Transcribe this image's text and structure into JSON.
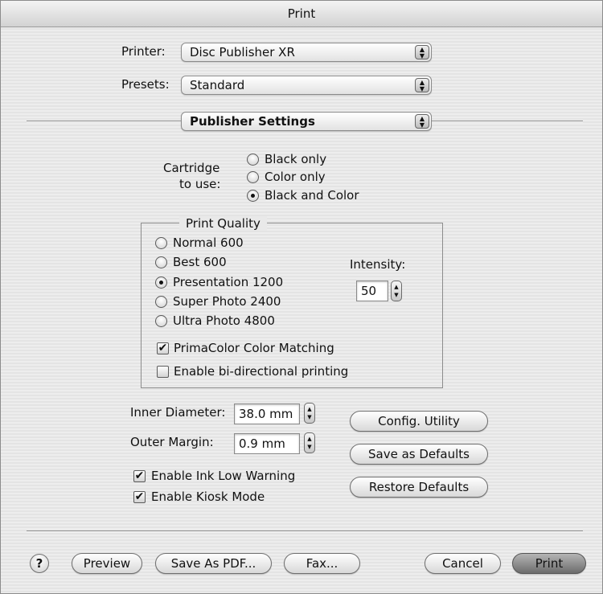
{
  "window": {
    "title": "Print"
  },
  "printer": {
    "label": "Printer:",
    "value": "Disc Publisher XR"
  },
  "presets": {
    "label": "Presets:",
    "value": "Standard"
  },
  "panel": {
    "value": "Publisher Settings"
  },
  "cartridge": {
    "label_line1": "Cartridge",
    "label_line2": "to use:",
    "options": [
      "Black only",
      "Color only",
      "Black and Color"
    ],
    "selected": "Black and Color"
  },
  "print_quality": {
    "title": "Print Quality",
    "options": [
      "Normal 600",
      "Best 600",
      "Presentation 1200",
      "Super Photo 2400",
      "Ultra Photo 4800"
    ],
    "selected": "Presentation 1200",
    "intensity_label": "Intensity:",
    "intensity_value": "50",
    "primacolor_label": "PrimaColor Color Matching",
    "primacolor_checked": true,
    "bidirectional_label": "Enable bi-directional printing",
    "bidirectional_checked": false
  },
  "inner_diameter": {
    "label": "Inner Diameter:",
    "value": "38.0 mm"
  },
  "outer_margin": {
    "label": "Outer Margin:",
    "value": "0.9 mm"
  },
  "ink_low": {
    "label": "Enable Ink Low Warning",
    "checked": true
  },
  "kiosk": {
    "label": "Enable Kiosk Mode",
    "checked": true
  },
  "buttons": {
    "config_utility": "Config. Utility",
    "save_defaults": "Save as Defaults",
    "restore_defaults": "Restore Defaults",
    "help": "?",
    "preview": "Preview",
    "save_pdf": "Save As PDF...",
    "fax": "Fax...",
    "cancel": "Cancel",
    "print": "Print"
  },
  "icons": {
    "popup_arrows": "up-down-arrows-icon",
    "checkmark": "✔",
    "stepper": "stepper-arrows-icon"
  },
  "colors": {
    "window_bg": "#ececec",
    "default_button": "#8a8a8a"
  }
}
